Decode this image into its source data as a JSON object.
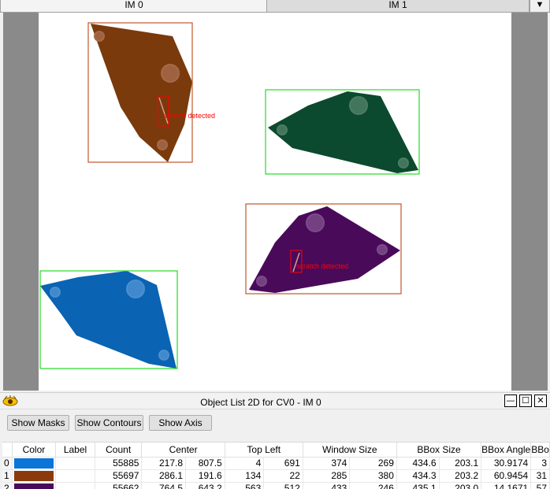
{
  "tabs": [
    {
      "label": "IM 0"
    },
    {
      "label": "IM 1"
    }
  ],
  "tab_menu_glyph": "▼",
  "canvas": {
    "objects": [
      {
        "fill": "#7a3a0c",
        "highlight": "#a66a4a",
        "box_color": "#c0582c",
        "label": "scratch detected"
      },
      {
        "fill": "#0b4a2e",
        "highlight": "#4c7c64",
        "box_color": "#22dd22",
        "label": ""
      },
      {
        "fill": "#4a0a5a",
        "highlight": "#7c4a8a",
        "box_color": "#c0582c",
        "label": "scratch detected"
      },
      {
        "fill": "#0a63b3",
        "highlight": "#4a8fd0",
        "box_color": "#22dd22",
        "label": ""
      }
    ],
    "defect_color": "#ff0000"
  },
  "object_window": {
    "title": "Object List 2D for CV0 - IM 0",
    "buttons": {
      "show_masks": "Show Masks",
      "show_contours": "Show Contours",
      "show_axis": "Show Axis"
    },
    "controls": {
      "minimize": "—",
      "maximize": "☐",
      "close": "✕"
    }
  },
  "table": {
    "headers": [
      "Color",
      "Label",
      "Count",
      "Center",
      "Top Left",
      "Window Size",
      "BBox Size",
      "BBox Angle",
      "BBo"
    ],
    "rows": [
      {
        "index": "0",
        "color": "#0a74d9",
        "label": "",
        "count": "55885",
        "center_x": "217.8",
        "center_y": "807.5",
        "tl_x": "4",
        "tl_y": "691",
        "win_w": "374",
        "win_h": "269",
        "bbox_w": "434.6",
        "bbox_h": "203.1",
        "angle": "30.9174",
        "extra": "3"
      },
      {
        "index": "1",
        "color": "#8b3a0e",
        "label": "",
        "count": "55697",
        "center_x": "286.1",
        "center_y": "191.6",
        "tl_x": "134",
        "tl_y": "22",
        "win_w": "285",
        "win_h": "380",
        "bbox_w": "434.3",
        "bbox_h": "203.2",
        "angle": "60.9454",
        "extra": "31"
      },
      {
        "index": "2",
        "color": "#4a0a5a",
        "label": "",
        "count": "55662",
        "center_x": "764.5",
        "center_y": "643.2",
        "tl_x": "563",
        "tl_y": "512",
        "win_w": "433",
        "win_h": "246",
        "bbox_w": "435.1",
        "bbox_h": "203.0",
        "angle": "14.1671",
        "extra": "57"
      }
    ]
  }
}
